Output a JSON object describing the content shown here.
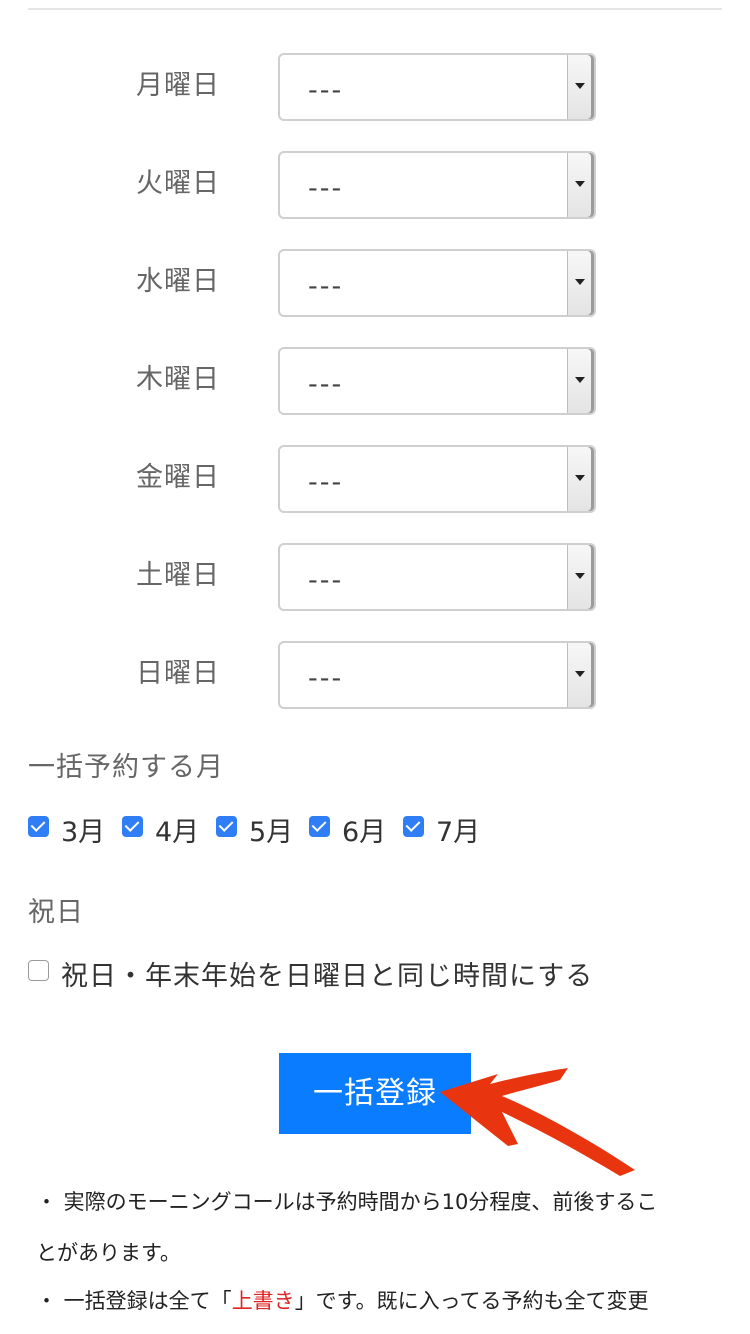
{
  "days": [
    {
      "label": "月曜日",
      "value": "---"
    },
    {
      "label": "火曜日",
      "value": "---"
    },
    {
      "label": "水曜日",
      "value": "---"
    },
    {
      "label": "木曜日",
      "value": "---"
    },
    {
      "label": "金曜日",
      "value": "---"
    },
    {
      "label": "土曜日",
      "value": "---"
    },
    {
      "label": "日曜日",
      "value": "---"
    }
  ],
  "months_section": {
    "title": "一括予約する月",
    "months": [
      {
        "label": "3月",
        "checked": true
      },
      {
        "label": "4月",
        "checked": true
      },
      {
        "label": "5月",
        "checked": true
      },
      {
        "label": "6月",
        "checked": true
      },
      {
        "label": "7月",
        "checked": true
      }
    ]
  },
  "holiday_section": {
    "title": "祝日",
    "checkbox_label": "祝日・年末年始を日曜日と同じ時間にする",
    "checked": false
  },
  "submit_label": "一括登録",
  "notes": {
    "line1": "・ 実際のモーニングコールは予約時間から10分程度、前後するこ",
    "line2": "とがあります。",
    "line3_prefix": "・ 一括登録は全て「",
    "line3_highlight": "上書き",
    "line3_suffix": "」です。既に入ってる予約も全て変更"
  },
  "colors": {
    "accent": "#0a7cff",
    "checkbox": "#2f7ef5",
    "highlight": "#e02424",
    "arrow": "#e8340f"
  }
}
